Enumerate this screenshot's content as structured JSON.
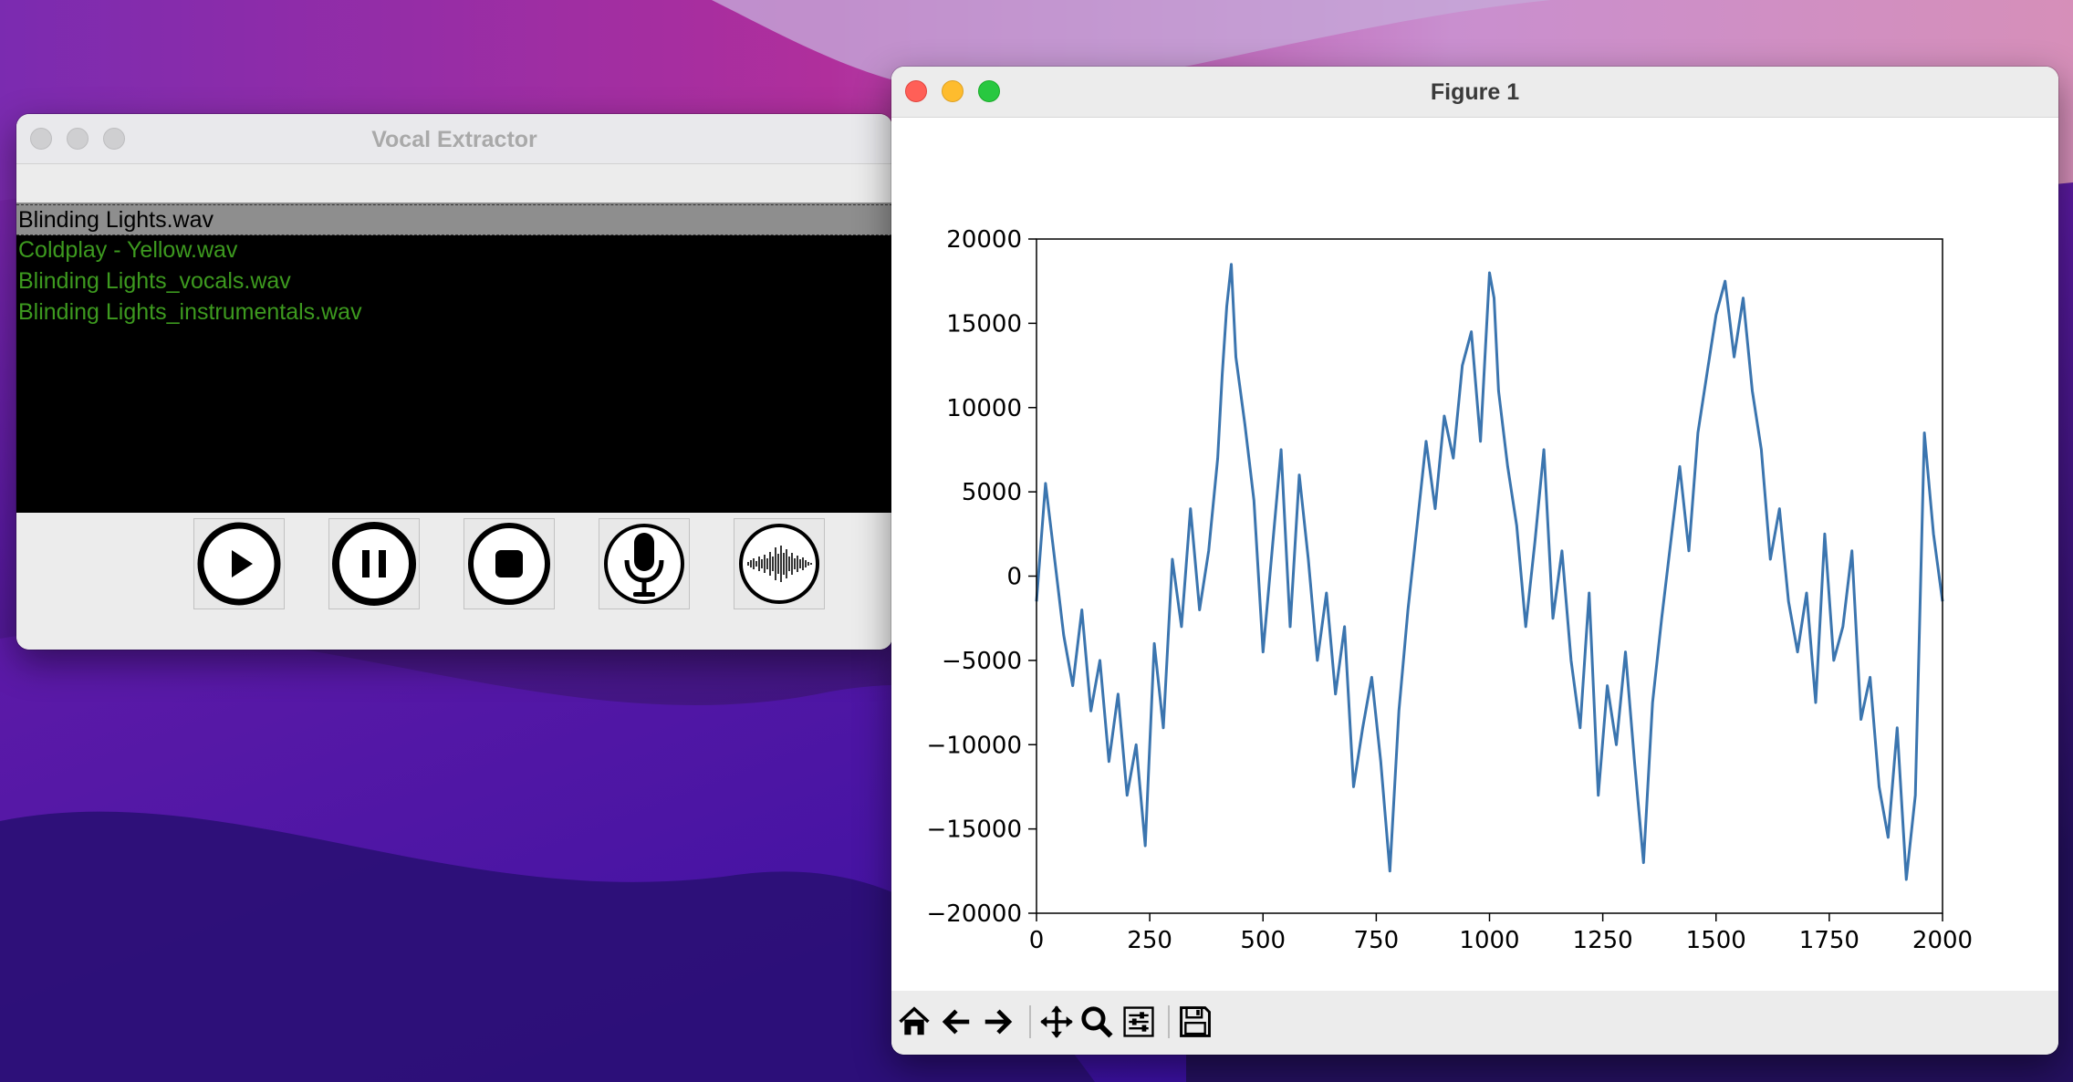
{
  "vocal_extractor": {
    "title": "Vocal Extractor",
    "files": [
      "Blinding Lights.wav",
      "Coldplay - Yellow.wav",
      "Blinding Lights_vocals.wav",
      "Blinding Lights_instrumentals.wav"
    ],
    "selected_index": 0,
    "controls": [
      "play-icon",
      "pause-icon",
      "stop-icon",
      "microphone-icon",
      "waveform-icon"
    ],
    "colors": {
      "list_text": "#3d9a1f",
      "list_bg": "#000000",
      "selected_bg": "#8e8e8e"
    }
  },
  "figure": {
    "title": "Figure 1",
    "toolbar": [
      "home-icon",
      "back-icon",
      "forward-icon",
      "pan-icon",
      "zoom-icon",
      "configure-subplots-icon",
      "save-icon"
    ]
  },
  "chart_data": {
    "type": "line",
    "title": "",
    "xlabel": "",
    "ylabel": "",
    "xlim": [
      0,
      2000
    ],
    "ylim": [
      -20000,
      20000
    ],
    "xticks": [
      0,
      250,
      500,
      750,
      1000,
      1250,
      1500,
      1750,
      2000
    ],
    "xtick_labels": [
      "0",
      "250",
      "500",
      "750",
      "1000",
      "1250",
      "1500",
      "1750",
      "2000"
    ],
    "yticks": [
      20000,
      15000,
      10000,
      5000,
      0,
      -5000,
      -10000,
      -15000,
      -20000
    ],
    "ytick_labels": [
      "20000",
      "15000",
      "10000",
      "5000",
      "0",
      "−5000",
      "−10000",
      "−15000",
      "−20000"
    ],
    "grid": false,
    "color": "#3b75af",
    "series": [
      {
        "x": [
          0,
          20,
          40,
          60,
          80,
          100,
          120,
          140,
          160,
          180,
          200,
          220,
          240,
          260,
          280,
          300,
          320,
          340,
          360,
          380,
          400,
          410,
          420,
          430,
          440,
          460,
          480,
          500,
          520,
          540,
          560,
          580,
          600,
          620,
          640,
          660,
          680,
          700,
          720,
          740,
          760,
          780,
          800,
          820,
          840,
          860,
          880,
          900,
          920,
          940,
          960,
          980,
          990,
          1000,
          1010,
          1020,
          1040,
          1060,
          1080,
          1100,
          1120,
          1140,
          1160,
          1180,
          1200,
          1220,
          1240,
          1260,
          1280,
          1300,
          1320,
          1340,
          1360,
          1380,
          1400,
          1420,
          1440,
          1460,
          1480,
          1500,
          1520,
          1540,
          1560,
          1580,
          1600,
          1620,
          1640,
          1660,
          1680,
          1700,
          1720,
          1740,
          1760,
          1780,
          1800,
          1820,
          1840,
          1860,
          1880,
          1900,
          1920,
          1940,
          1960,
          1980,
          2000
        ],
        "y": [
          -1500,
          5500,
          1000,
          -3500,
          -6500,
          -2000,
          -8000,
          -5000,
          -11000,
          -7000,
          -13000,
          -10000,
          -16000,
          -4000,
          -9000,
          1000,
          -3000,
          4000,
          -2000,
          1500,
          7000,
          12000,
          16000,
          18500,
          13000,
          9000,
          4500,
          -4500,
          1500,
          7500,
          -3000,
          6000,
          1000,
          -5000,
          -1000,
          -7000,
          -3000,
          -12500,
          -9000,
          -6000,
          -11000,
          -17500,
          -8000,
          -2000,
          3000,
          8000,
          4000,
          9500,
          7000,
          12500,
          14500,
          8000,
          13000,
          18000,
          16500,
          11000,
          6500,
          3000,
          -3000,
          2000,
          7500,
          -2500,
          1500,
          -5000,
          -9000,
          -1000,
          -13000,
          -6500,
          -10000,
          -4500,
          -11000,
          -17000,
          -7500,
          -2500,
          2000,
          6500,
          1500,
          8500,
          12000,
          15500,
          17500,
          13000,
          16500,
          11000,
          7500,
          1000,
          4000,
          -1500,
          -4500,
          -1000,
          -7500,
          2500,
          -5000,
          -3000,
          1500,
          -8500,
          -6000,
          -12500,
          -15500,
          -9000,
          -18000,
          -13000,
          8500,
          2500,
          -1500
        ]
      }
    ]
  }
}
